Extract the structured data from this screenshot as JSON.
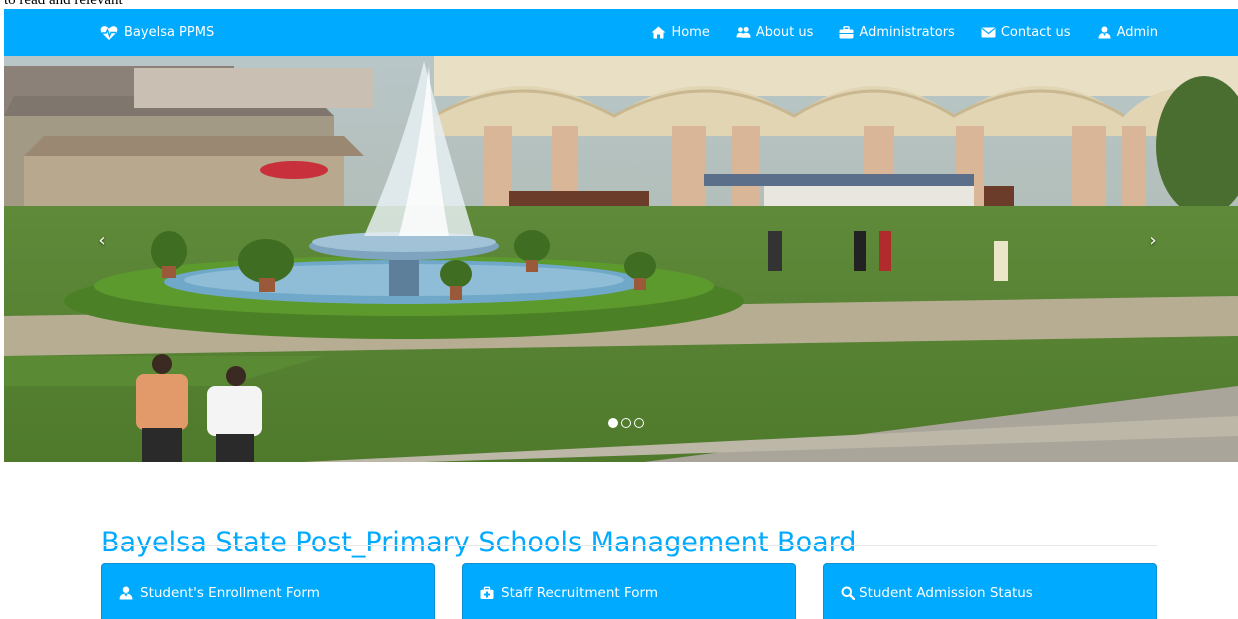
{
  "top_text": "to read and relevant",
  "navbar": {
    "brand": "Bayelsa PPMS",
    "links": [
      {
        "label": "Home",
        "icon": "home-icon"
      },
      {
        "label": "About us",
        "icon": "users-icon"
      },
      {
        "label": "Administrators",
        "icon": "briefcase-icon"
      },
      {
        "label": "Contact us",
        "icon": "envelope-icon"
      },
      {
        "label": "Admin",
        "icon": "user-icon"
      }
    ]
  },
  "carousel": {
    "prev": "‹",
    "next": "›",
    "slide_count": 3,
    "active_slide": 1
  },
  "main": {
    "title": "Bayelsa State Post_Primary Schools Management Board",
    "panels": [
      {
        "label": "Student's Enrollment Form",
        "icon": "user-icon"
      },
      {
        "label": "Staff Recruitment Form",
        "icon": "medkit-icon"
      },
      {
        "label": "Student Admission Status",
        "icon": "search-icon"
      }
    ]
  },
  "colors": {
    "primary": "#00aaff"
  }
}
